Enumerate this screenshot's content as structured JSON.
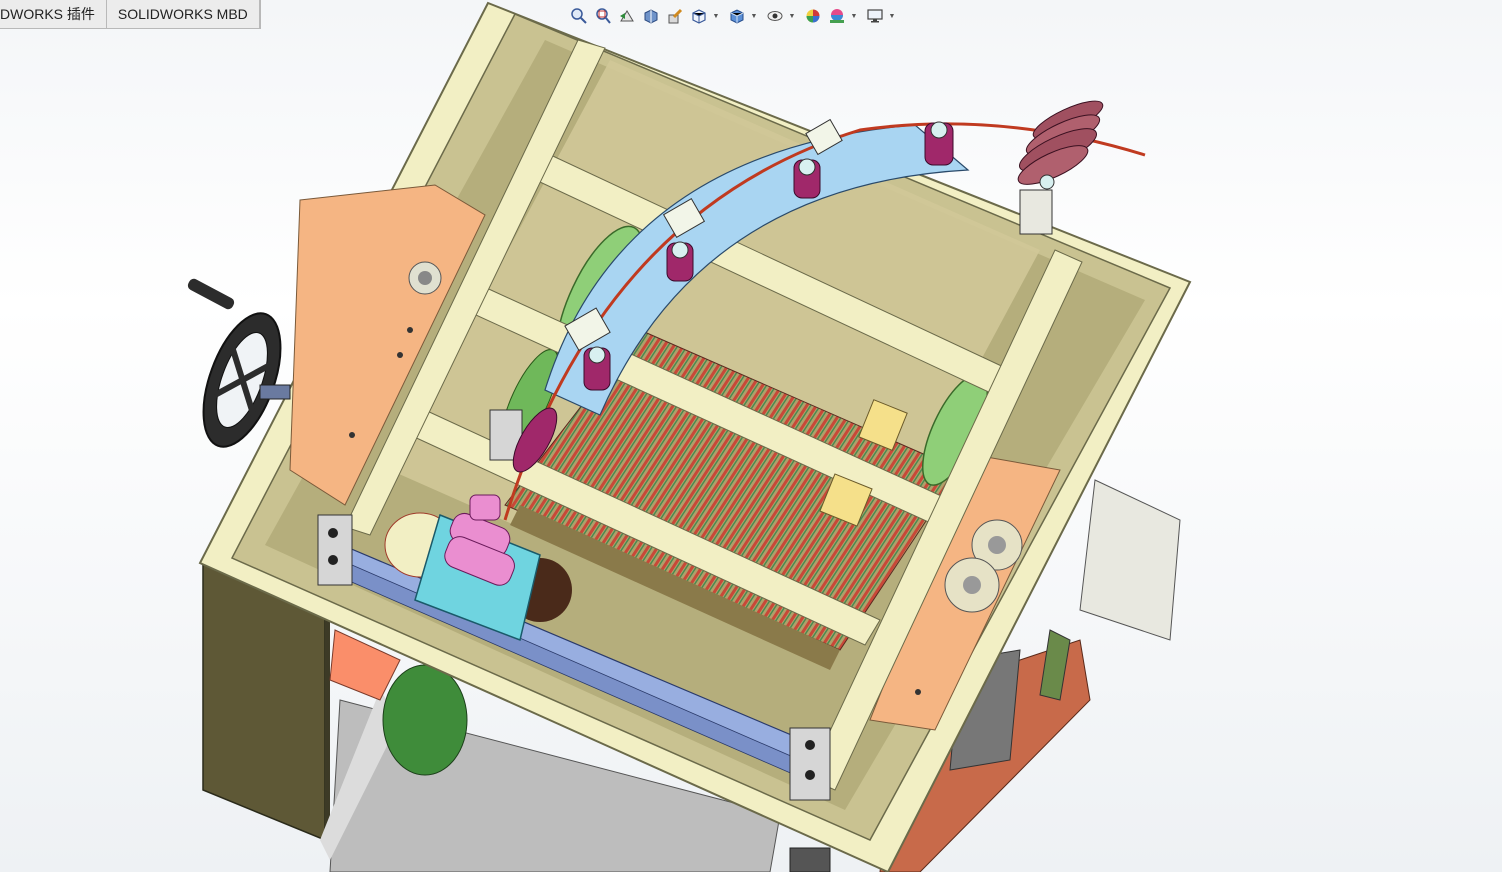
{
  "tabs": [
    {
      "label": "DWORKS 插件"
    },
    {
      "label": "SOLIDWORKS MBD"
    }
  ],
  "heads_up_toolbar": [
    {
      "icon": "zoom-to-fit-icon"
    },
    {
      "icon": "zoom-to-area-icon"
    },
    {
      "icon": "previous-view-icon"
    },
    {
      "icon": "section-view-icon"
    },
    {
      "icon": "dynamic-annotation-icon"
    },
    {
      "icon": "view-orientation-icon",
      "dropdown": true
    },
    {
      "icon": "display-style-icon",
      "dropdown": true
    },
    {
      "icon": "hide-show-items-icon",
      "dropdown": true
    },
    {
      "icon": "edit-appearance-icon"
    },
    {
      "icon": "apply-scene-icon",
      "dropdown": true
    },
    {
      "icon": "view-settings-icon",
      "dropdown": true
    }
  ],
  "colors": {
    "frame": "#f2efc4",
    "frame_edge": "#6b6a4a",
    "interior": "#c9c291",
    "side_plate": "#f5b583",
    "guide_arc": "#a9d5f2",
    "roller": "#a0286a",
    "pulley": "#a05060",
    "rod": "#98aee0",
    "cyan_block": "#6fd4e0",
    "pink_roller": "#ea8ed0",
    "green_wheel": "#8fcf78",
    "coil": "#c84838",
    "body_dark": "#5e5836",
    "salmon": "#fa8e6a"
  }
}
